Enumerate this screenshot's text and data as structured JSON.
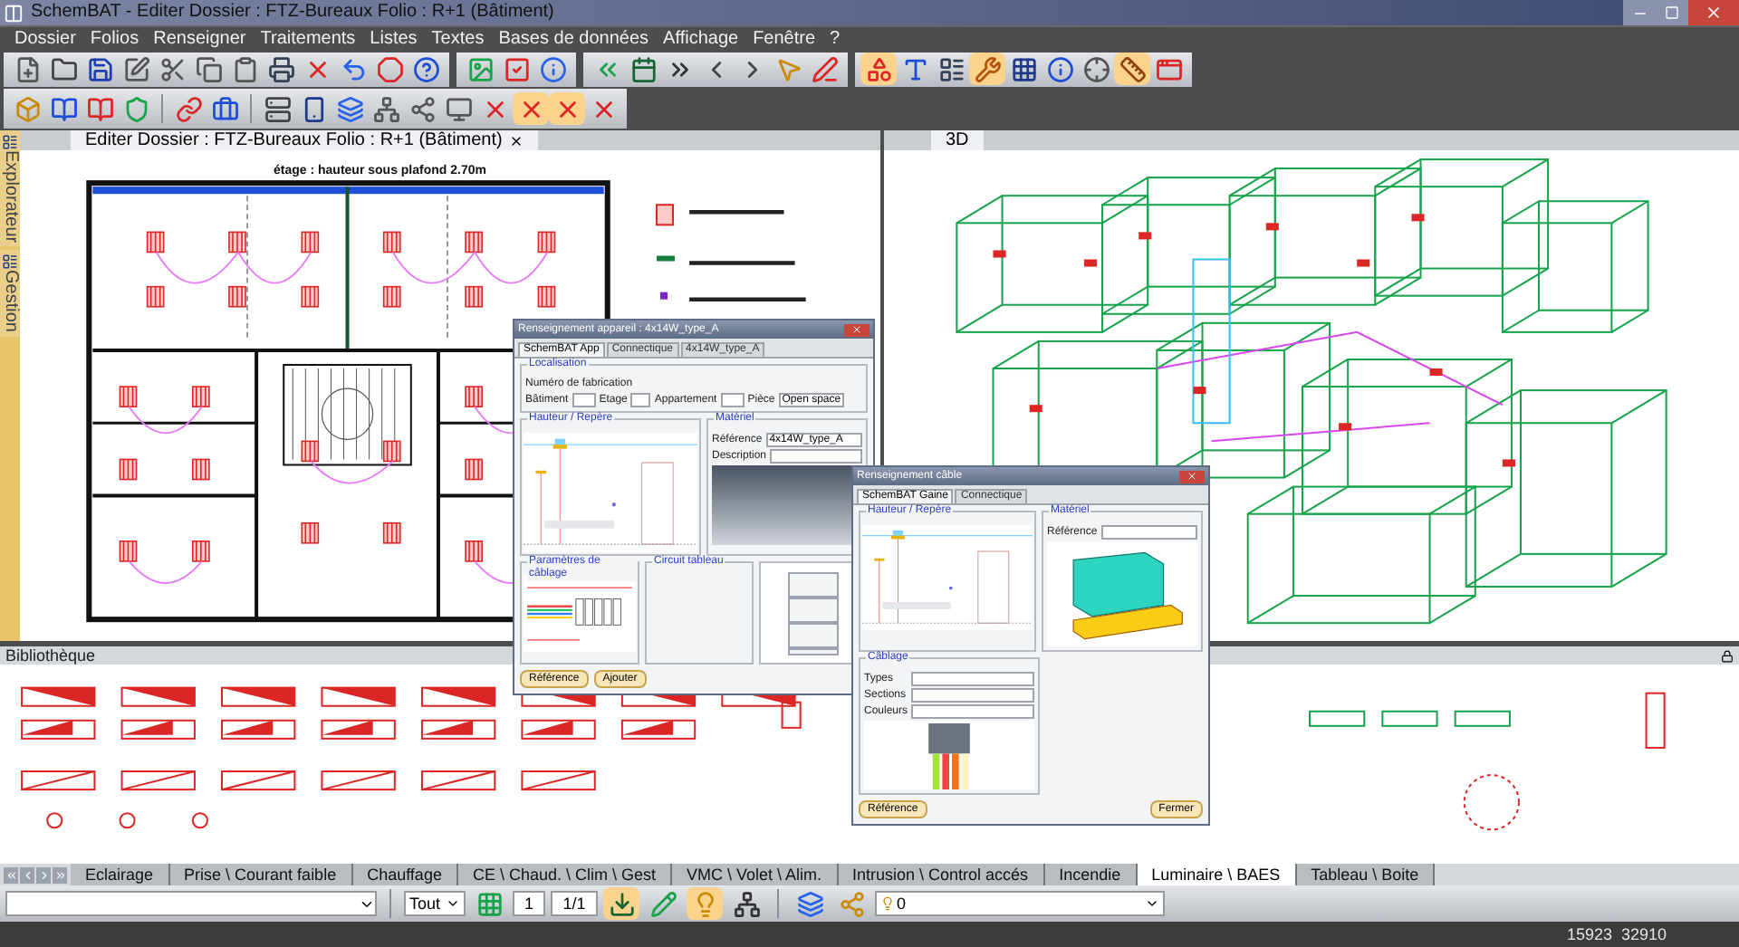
{
  "window": {
    "title": "SchemBAT - Editer  Dossier : FTZ-Bureaux  Folio : R+1  (Bâtiment)"
  },
  "menu": [
    "Dossier",
    "Folios",
    "Renseigner",
    "Traitements",
    "Listes",
    "Textes",
    "Bases de données",
    "Affichage",
    "Fenêtre",
    "?"
  ],
  "side_tabs": [
    {
      "label": "Explorateur"
    },
    {
      "label": "Gestion"
    }
  ],
  "editor": {
    "tab": "Editer  Dossier : FTZ-Bureaux  Folio : R+1  (Bâtiment)",
    "plan_title": "étage : hauteur sous plafond 2.70m"
  },
  "view3d": {
    "tab": "3D"
  },
  "dialog_device": {
    "title": "Renseignement appareil : 4x14W_type_A",
    "tabs": [
      {
        "label": "SchemBAT App",
        "selected": true
      },
      {
        "label": "Connectique",
        "selected": false
      },
      {
        "label": "4x14W_type_A",
        "selected": false
      }
    ],
    "location": {
      "legend": "Localisation",
      "serial_label": "Numéro de fabrication",
      "building_label": "Bâtiment",
      "floor_label": "Etage",
      "flat_label": "Appartement",
      "room_label": "Pièce",
      "room_value": "Open space"
    },
    "height_legend": "Hauteur / Repère",
    "material": {
      "legend": "Matériel",
      "reference_label": "Référence",
      "reference_value": "4x14W_type_A",
      "description_label": "Description"
    },
    "wiring_legend": "Paramètres de câblage",
    "circuit_legend": "Circuit tableau",
    "buttons": [
      "Référence",
      "Ajouter"
    ]
  },
  "dialog_cable": {
    "title": "Renseignement câble",
    "tabs": [
      {
        "label": "SchemBAT Gaine",
        "selected": true
      },
      {
        "label": "Connectique",
        "selected": false
      }
    ],
    "height_legend": "Hauteur / Repère",
    "material": {
      "legend": "Matériel",
      "reference_label": "Référence"
    },
    "wiring": {
      "legend": "Câblage",
      "rows": [
        "Types",
        "Sections",
        "Couleurs"
      ]
    },
    "buttons": [
      "Référence",
      "Fermer"
    ]
  },
  "library": {
    "title": "Bibliothèque"
  },
  "category_tabs": [
    {
      "label": "Eclairage",
      "selected": false
    },
    {
      "label": "Prise \\ Courant faible",
      "selected": false
    },
    {
      "label": "Chauffage",
      "selected": false
    },
    {
      "label": "CE \\ Chaud. \\ Clim \\ Gest",
      "selected": false
    },
    {
      "label": "VMC \\ Volet \\ Alim.",
      "selected": false
    },
    {
      "label": "Intrusion \\ Control accés",
      "selected": false
    },
    {
      "label": "Incendie",
      "selected": false
    },
    {
      "label": "Luminaire \\ BAES",
      "selected": true
    },
    {
      "label": "Tableau \\ Boite",
      "selected": false
    }
  ],
  "bottom_toolbar": {
    "filter": "Tout",
    "page": "1",
    "pages": "1/1",
    "layer": "0"
  },
  "status": {
    "coords": "15923  32910"
  }
}
